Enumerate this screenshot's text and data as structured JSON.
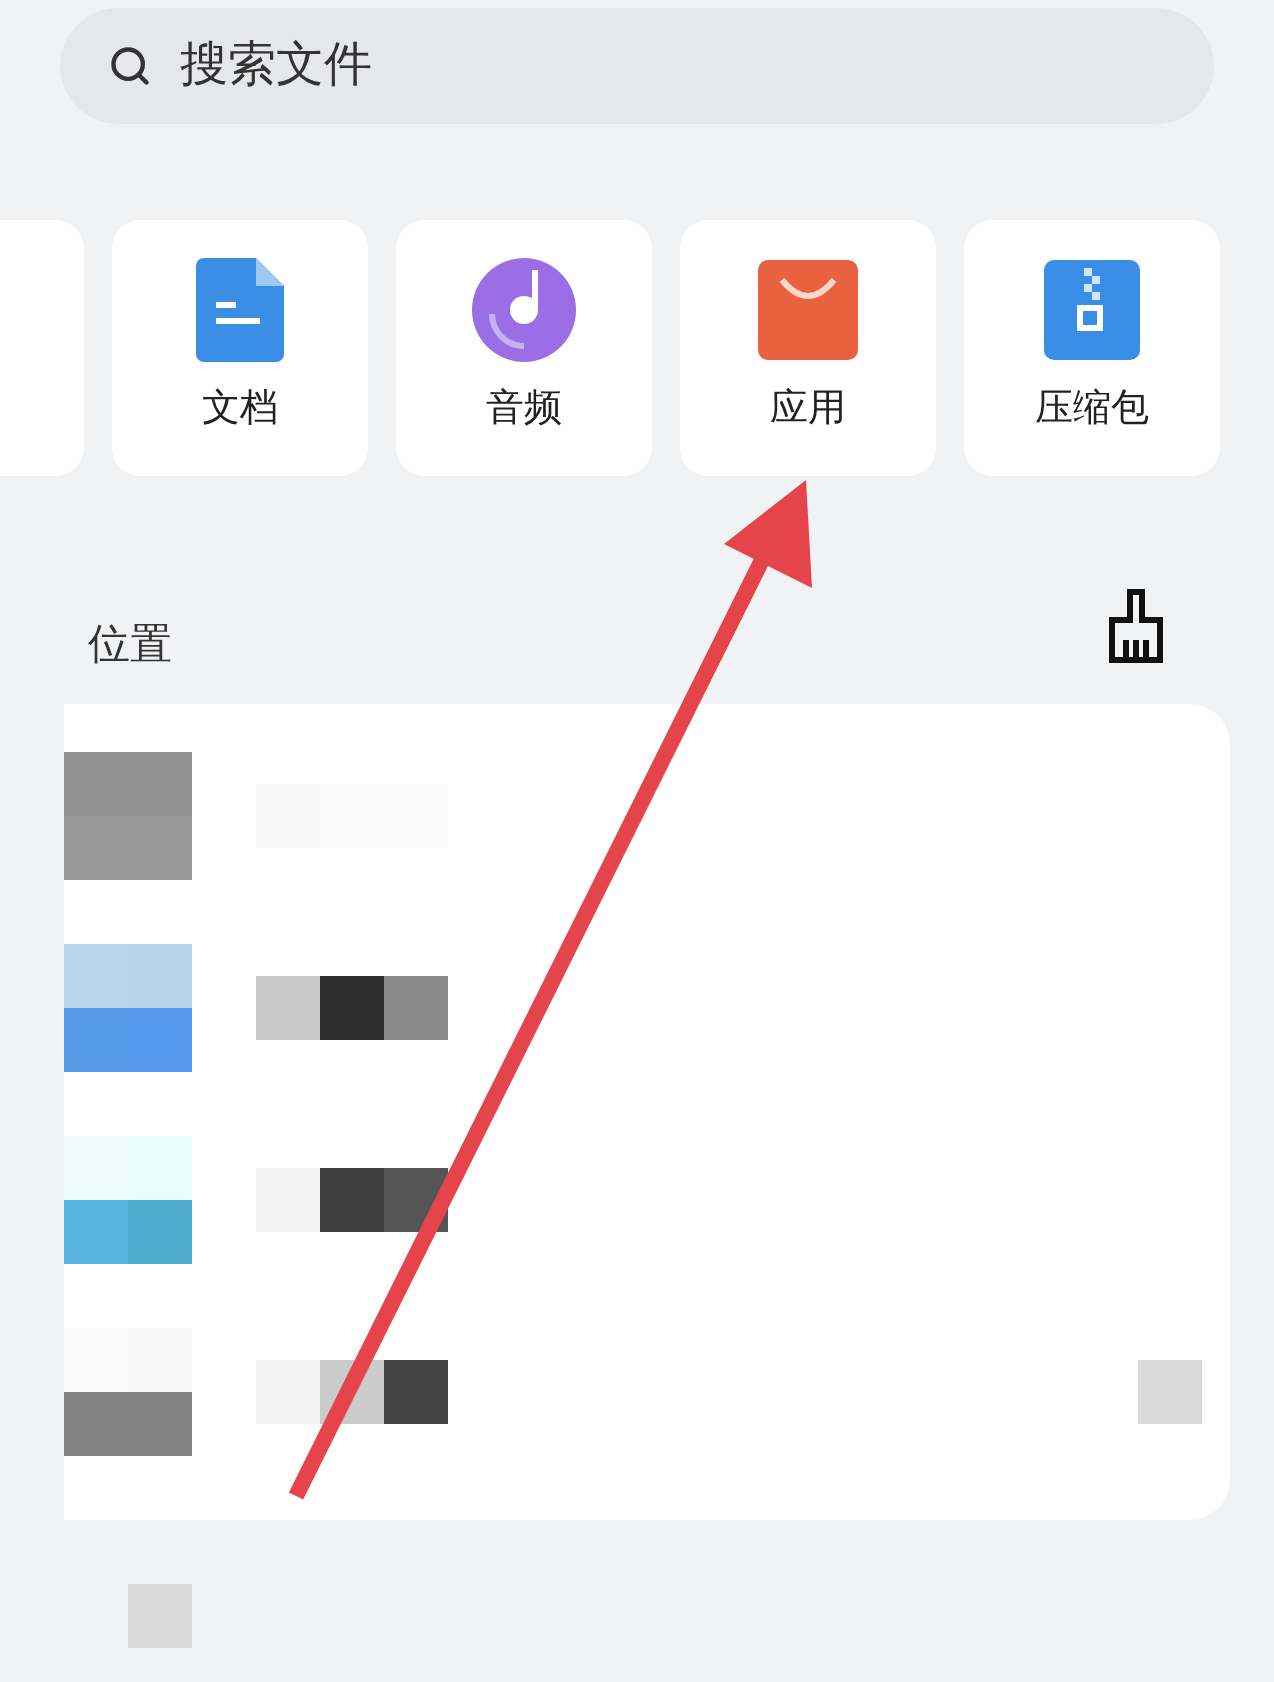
{
  "search": {
    "placeholder": "搜索文件"
  },
  "categories": [
    {
      "kind": "partial"
    },
    {
      "kind": "document",
      "label": "文档"
    },
    {
      "kind": "audio",
      "label": "音频"
    },
    {
      "kind": "app",
      "label": "应用"
    },
    {
      "kind": "archive",
      "label": "压缩包"
    }
  ],
  "section": {
    "title": "位置"
  }
}
